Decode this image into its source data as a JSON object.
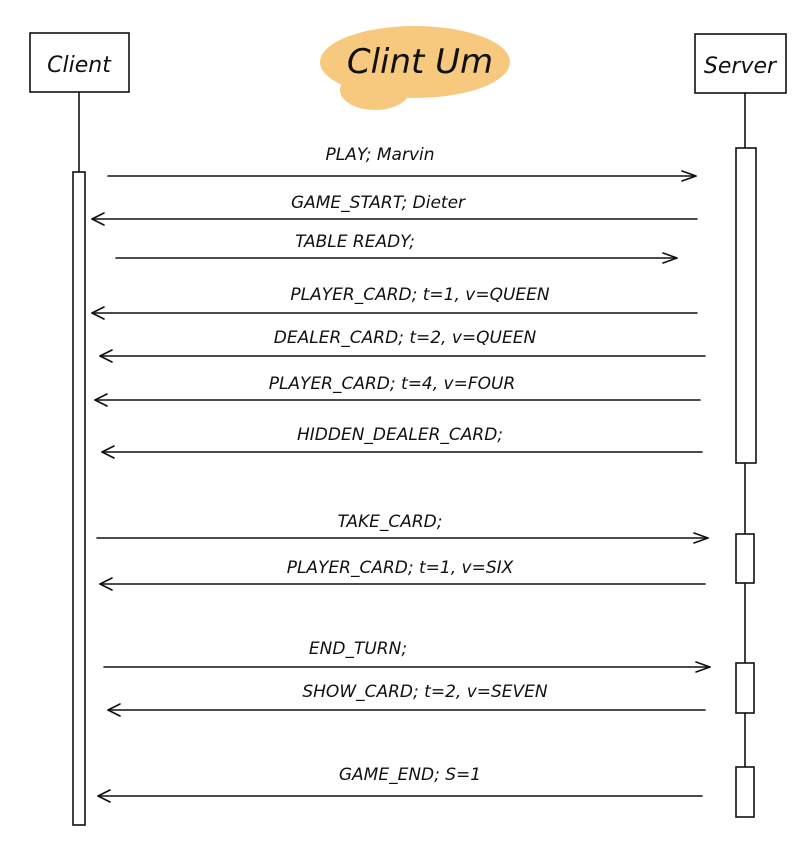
{
  "title": "Clint Um",
  "highlight_color": "#f6c97e",
  "participants": {
    "client": "Client",
    "server": "Server"
  },
  "messages": [
    {
      "label": "PLAY; Marvin",
      "direction": "to-server"
    },
    {
      "label": "GAME_START; Dieter",
      "direction": "to-client"
    },
    {
      "label": "TABLE READY;",
      "direction": "to-server"
    },
    {
      "label": "PLAYER_CARD; t=1, v=QUEEN",
      "direction": "to-client"
    },
    {
      "label": "DEALER_CARD; t=2, v=QUEEN",
      "direction": "to-client"
    },
    {
      "label": "PLAYER_CARD; t=4, v=FOUR",
      "direction": "to-client"
    },
    {
      "label": "HIDDEN_DEALER_CARD;",
      "direction": "to-client"
    },
    {
      "label": "TAKE_CARD;",
      "direction": "to-server"
    },
    {
      "label": "PLAYER_CARD; t=1, v=SIX",
      "direction": "to-client"
    },
    {
      "label": "END_TURN;",
      "direction": "to-server"
    },
    {
      "label": "SHOW_CARD; t=2, v=SEVEN",
      "direction": "to-client"
    },
    {
      "label": "GAME_END; S=1",
      "direction": "to-client"
    }
  ]
}
